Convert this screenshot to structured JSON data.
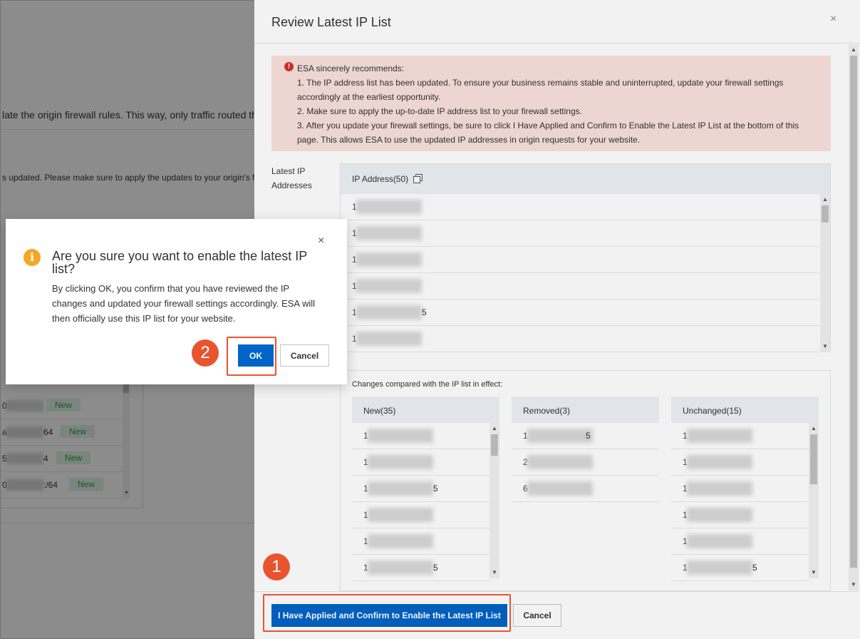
{
  "background": {
    "line1": "late the origin firewall rules. This way, only traffic routed th",
    "line2": "s updated. Please make sure to apply the updates to your origin's fi",
    "rows": [
      {
        "ip_prefix": "0:",
        "ip_suffix": "",
        "badge": "New"
      },
      {
        "ip_prefix": "a:",
        "ip_suffix": "64",
        "badge": "New"
      },
      {
        "ip_prefix": "5:",
        "ip_suffix": "4",
        "badge": "New"
      },
      {
        "ip_prefix": "0:",
        "ip_suffix": ":/64",
        "badge": "New"
      }
    ]
  },
  "drawer": {
    "title": "Review Latest IP List",
    "close_glyph": "×",
    "alert": {
      "icon_glyph": "!",
      "heading": "ESA sincerely recommends:",
      "line1": "1. The IP address list has been updated. To ensure your business remains stable and uninterrupted, update your firewall settings accordingly at the earliest opportunity.",
      "line2": "2. Make sure to apply the up-to-date IP address list to your firewall settings.",
      "line3": "3. After you update your firewall settings, be sure to click I Have Applied and Confirm to Enable the Latest IP List at the bottom of this page. This allows ESA to use the updated IP addresses in origin requests for your website."
    },
    "latest_label": "Latest IP Addresses",
    "ip_header": "IP Address(50)",
    "ip_rows": [
      "1",
      "1",
      "1",
      "1",
      "1",
      "1"
    ],
    "ip_row_tails": [
      "",
      "",
      "",
      "",
      "5",
      ""
    ],
    "changes_title": "Changes compared with the IP list in effect:",
    "columns": [
      {
        "title": "New(35)",
        "rows": [
          "1",
          "1",
          "1",
          "1",
          "1",
          "1"
        ],
        "tails": [
          "",
          "",
          "5",
          "",
          "",
          "5"
        ]
      },
      {
        "title": "Removed(3)",
        "rows": [
          "1",
          "2",
          "6"
        ],
        "tails": [
          "5",
          "",
          ""
        ]
      },
      {
        "title": "Unchanged(15)",
        "rows": [
          "1",
          "1",
          "1",
          "1",
          "1",
          "1"
        ],
        "tails": [
          "",
          "",
          "",
          "",
          "",
          "5"
        ]
      }
    ],
    "confirm_button": "I Have Applied and Confirm to Enable the Latest IP List",
    "cancel_button": "Cancel"
  },
  "dialog": {
    "icon_glyph": "i",
    "title": "Are you sure you want to enable the latest IP list?",
    "body": "By clicking OK, you confirm that you have reviewed the IP changes and updated your firewall settings accordingly. ESA will then officially use this IP list for your website.",
    "ok_button": "OK",
    "cancel_button": "Cancel",
    "close_glyph": "×"
  },
  "annotations": {
    "step1": "1",
    "step2": "2",
    "highlight_color": "#e8542f"
  },
  "colors": {
    "primary": "#0064c8",
    "alert_bg": "#fae1de",
    "error_icon": "#d93026",
    "warning_icon": "#f5a623",
    "new_badge_text": "#2a9d4b"
  }
}
